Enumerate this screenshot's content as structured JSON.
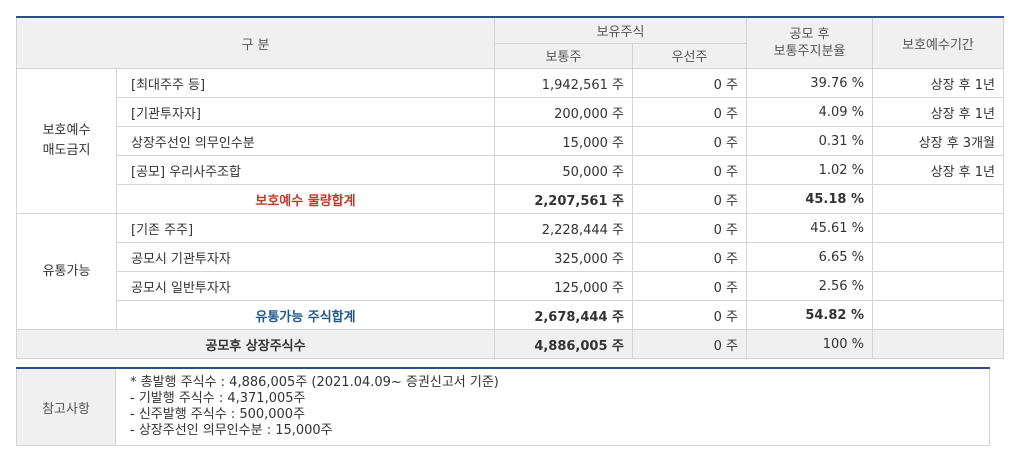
{
  "header": {
    "category": "구 분",
    "holdings": "보유주식",
    "common": "보통주",
    "preferred": "우선주",
    "ratio": "공모 후\n보통주지분율",
    "ratio_line1": "공모 후",
    "ratio_line2": "보통주지분율",
    "period": "보호예수기간"
  },
  "groups": {
    "locked_label_1": "보호예수",
    "locked_label_2": "매도금지",
    "tradable_label": "유통가능"
  },
  "locked_rows": [
    {
      "label": "[최대주주 등]",
      "common": "1,942,561 주",
      "preferred": "0 주",
      "ratio": "39.76 %",
      "period": "상장 후 1년"
    },
    {
      "label": "[기관투자자]",
      "common": "200,000 주",
      "preferred": "0 주",
      "ratio": "4.09 %",
      "period": "상장 후 1년"
    },
    {
      "label": "상장주선인 의무인수분",
      "common": "15,000 주",
      "preferred": "0 주",
      "ratio": "0.31 %",
      "period": "상장 후 3개월"
    },
    {
      "label": "[공모] 우리사주조합",
      "common": "50,000 주",
      "preferred": "0 주",
      "ratio": "1.02 %",
      "period": "상장 후 1년"
    }
  ],
  "locked_total": {
    "label": "보호예수 물량합계",
    "common": "2,207,561 주",
    "preferred": "0 주",
    "ratio": "45.18 %"
  },
  "tradable_rows": [
    {
      "label": "[기존 주주]",
      "common": "2,228,444 주",
      "preferred": "0 주",
      "ratio": "45.61 %"
    },
    {
      "label": "공모시 기관투자자",
      "common": "325,000 주",
      "preferred": "0 주",
      "ratio": "6.65 %"
    },
    {
      "label": "공모시 일반투자자",
      "common": "125,000 주",
      "preferred": "0 주",
      "ratio": "2.56 %"
    }
  ],
  "tradable_total": {
    "label": "유통가능 주식합계",
    "common": "2,678,444 주",
    "preferred": "0 주",
    "ratio": "54.82 %"
  },
  "grand_total": {
    "label": "공모후 상장주식수",
    "common": "4,886,005 주",
    "preferred": "0 주",
    "ratio": "100 %"
  },
  "note": {
    "label": "참고사항",
    "lines": [
      "* 총발행 주식수 : 4,886,005주 (2021.04.09~ 증권신고서 기준)",
      "- 기발행 주식수 : 4,371,005주",
      "- 신주발행 주식수 : 500,000주",
      "- 상장주선인 의무인수분 : 15,000주"
    ]
  }
}
